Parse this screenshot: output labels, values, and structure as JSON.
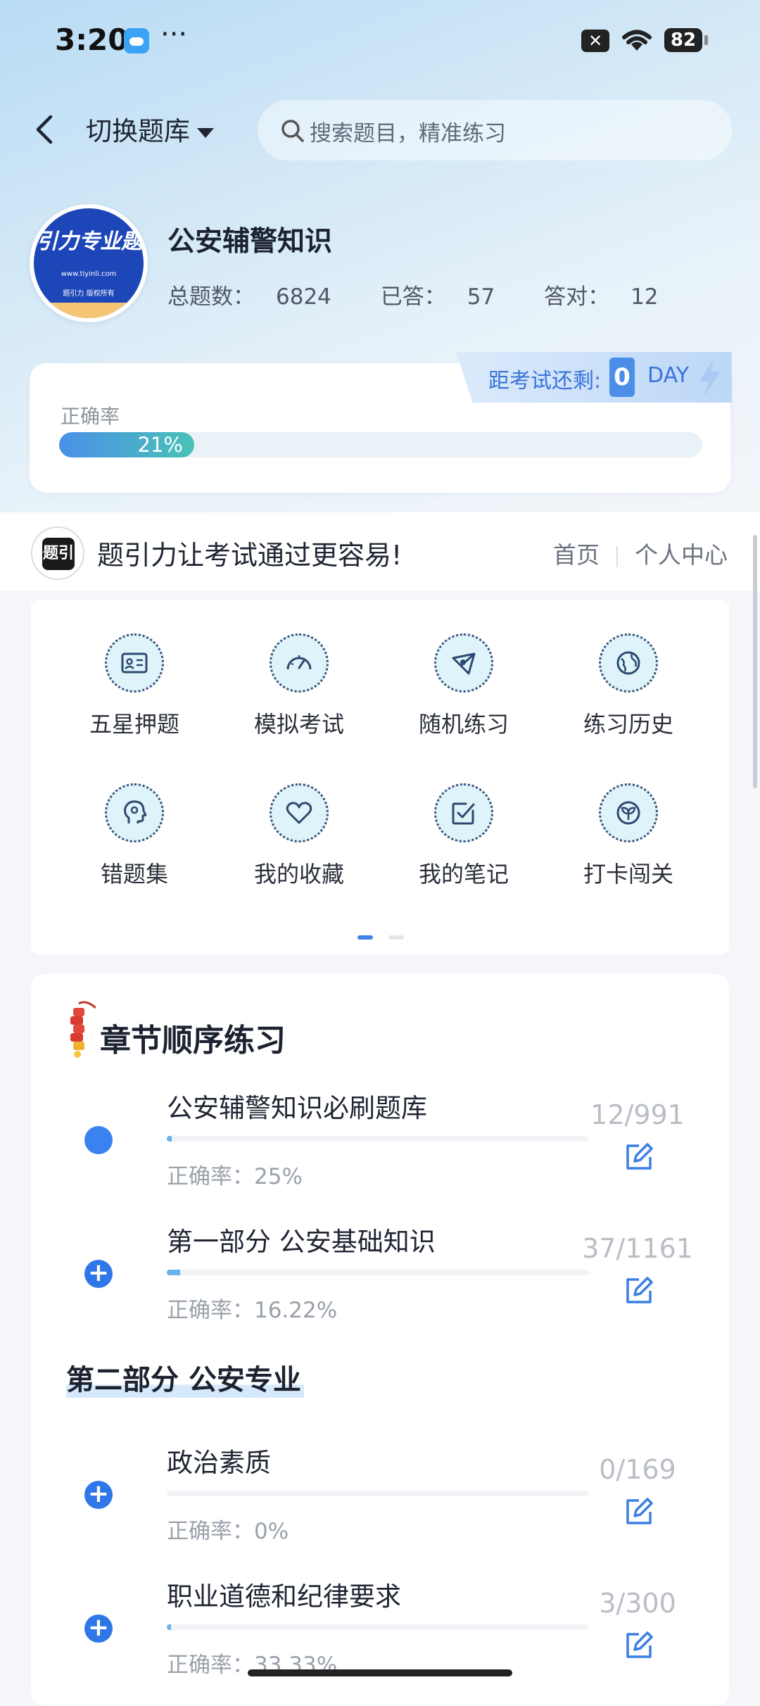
{
  "status_bar": {
    "time": "3:20",
    "more": "···",
    "notification": "✕",
    "battery": "82"
  },
  "header": {
    "switch_label": "切换题库",
    "search_placeholder": "搜索题目，精准练习"
  },
  "bank": {
    "logo_brand": "引力专业题",
    "logo_site": "www.tiyinli.com",
    "logo_copyright": "题引力 版权所有",
    "title": "公安辅警知识",
    "total_label": "总题数：",
    "total": "6824",
    "answered_label": "已答：",
    "answered": "57",
    "correct_label": "答对：",
    "correct": "12"
  },
  "countdown": {
    "label": "距考试还剩:",
    "days": "0",
    "unit": "DAY"
  },
  "accuracy": {
    "label": "正确率",
    "percent_text": "21%",
    "value": 0.21
  },
  "slogan": {
    "badge": "题引",
    "text": "题引力让考试通过更容易!",
    "nav_home": "首页",
    "nav_profile": "个人中心"
  },
  "functions": [
    {
      "label": "五星押题",
      "icon": "id-card-icon"
    },
    {
      "label": "模拟考试",
      "icon": "speedometer-icon"
    },
    {
      "label": "随机练习",
      "icon": "network-icon"
    },
    {
      "label": "练习历史",
      "icon": "globe-icon"
    },
    {
      "label": "错题集",
      "icon": "head-icon"
    },
    {
      "label": "我的收藏",
      "icon": "heart-icon"
    },
    {
      "label": "我的笔记",
      "icon": "note-check-icon"
    },
    {
      "label": "打卡闯关",
      "icon": "sprout-icon"
    }
  ],
  "chapters": {
    "title": "章节顺序练习",
    "rate_label": "正确率：",
    "items": [
      {
        "name": "公安辅警知识必刷题库",
        "rate": "25%",
        "count": "12/991",
        "progress": 0.012,
        "marker": "dot"
      },
      {
        "name": "第一部分 公安基础知识",
        "rate": "16.22%",
        "count": "37/1161",
        "progress": 0.032,
        "marker": "plus"
      }
    ],
    "part_title": "第二部分 公安专业",
    "part_items": [
      {
        "name": "政治素质",
        "rate": "0%",
        "count": "0/169",
        "progress": 0.0,
        "marker": "plus"
      },
      {
        "name": "职业道德和纪律要求",
        "rate": "33.33%",
        "count": "3/300",
        "progress": 0.01,
        "marker": "plus"
      }
    ]
  },
  "colors": {
    "accent": "#3b82f0",
    "progress_start": "#4a90e8",
    "progress_end": "#49c2b6"
  }
}
